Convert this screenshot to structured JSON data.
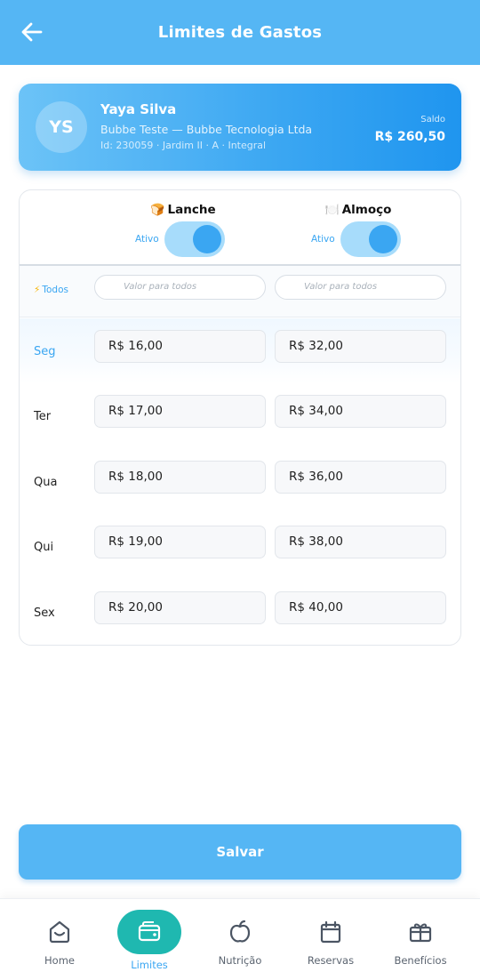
{
  "header": {
    "title": "Limites de Gastos"
  },
  "profile": {
    "initials": "YS",
    "name": "Yaya Silva",
    "company": "Bubbe Teste — Bubbe Tecnologia Ltda",
    "meta": "Id: 230059 · Jardim II · A · Integral",
    "saldo_label": "Saldo",
    "saldo_value": "R$ 260,50"
  },
  "limits": {
    "columns": [
      {
        "emoji": "🍞",
        "title": "Lanche",
        "toggle_label": "Ativo",
        "enabled": true
      },
      {
        "emoji": "🍽️",
        "title": "Almoço",
        "toggle_label": "Ativo",
        "enabled": true
      }
    ],
    "todos": {
      "label": "Todos",
      "placeholder": "Valor para todos"
    },
    "days": [
      {
        "label": "Seg",
        "lanche": "R$ 16,00",
        "almoco": "R$ 32,00",
        "active": true
      },
      {
        "label": "Ter",
        "lanche": "R$ 17,00",
        "almoco": "R$ 34,00",
        "active": false
      },
      {
        "label": "Qua",
        "lanche": "R$ 18,00",
        "almoco": "R$ 36,00",
        "active": false
      },
      {
        "label": "Qui",
        "lanche": "R$ 19,00",
        "almoco": "R$ 38,00",
        "active": false
      },
      {
        "label": "Sex",
        "lanche": "R$ 20,00",
        "almoco": "R$ 40,00",
        "active": false
      }
    ]
  },
  "save_label": "Salvar",
  "nav": [
    {
      "label": "Home",
      "icon": "home-icon",
      "active": false
    },
    {
      "label": "Limites",
      "icon": "wallet-icon",
      "active": true
    },
    {
      "label": "Nutrição",
      "icon": "apple-icon",
      "active": false
    },
    {
      "label": "Reservas",
      "icon": "calendar-icon",
      "active": false
    },
    {
      "label": "Benefícios",
      "icon": "gift-icon",
      "active": false
    }
  ],
  "colors": {
    "primary": "#55b6f4",
    "accent": "#3aa6f2",
    "active_pill": "#1fb8b0"
  }
}
